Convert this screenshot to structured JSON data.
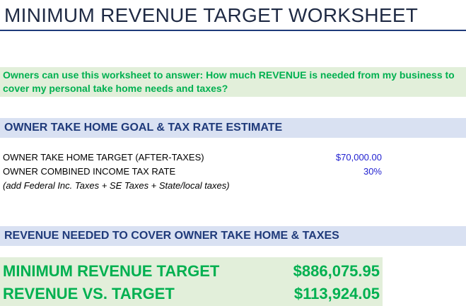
{
  "title": "MINIMUM REVENUE TARGET WORKSHEET",
  "intro": "Owners can use this worksheet to answer: How much REVENUE is needed from my business to cover my personal take home needs and taxes?",
  "section_take_home": {
    "heading": "OWNER TAKE HOME GOAL & TAX RATE ESTIMATE",
    "rows": [
      {
        "label": "OWNER TAKE HOME TARGET (AFTER-TAXES)",
        "value": "$70,000.00"
      },
      {
        "label": "OWNER COMBINED INCOME TAX RATE",
        "value": "30%"
      }
    ],
    "note": "(add Federal Inc. Taxes + SE Taxes + State/local taxes)"
  },
  "section_revenue": {
    "heading": "REVENUE NEEDED TO COVER OWNER TAKE HOME & TAXES",
    "results": [
      {
        "label": "MINIMUM REVENUE TARGET",
        "value": "$886,075.95"
      },
      {
        "label": "REVENUE VS. TARGET",
        "value": "$113,924.05"
      }
    ]
  },
  "colors": {
    "title_text": "#1f2a44",
    "rule": "#1f3a7a",
    "section_band": "#d9e1f2",
    "section_text": "#1f3a7a",
    "green_band": "#e2efda",
    "green_text": "#00b050",
    "input_value": "#1f1fd0"
  }
}
